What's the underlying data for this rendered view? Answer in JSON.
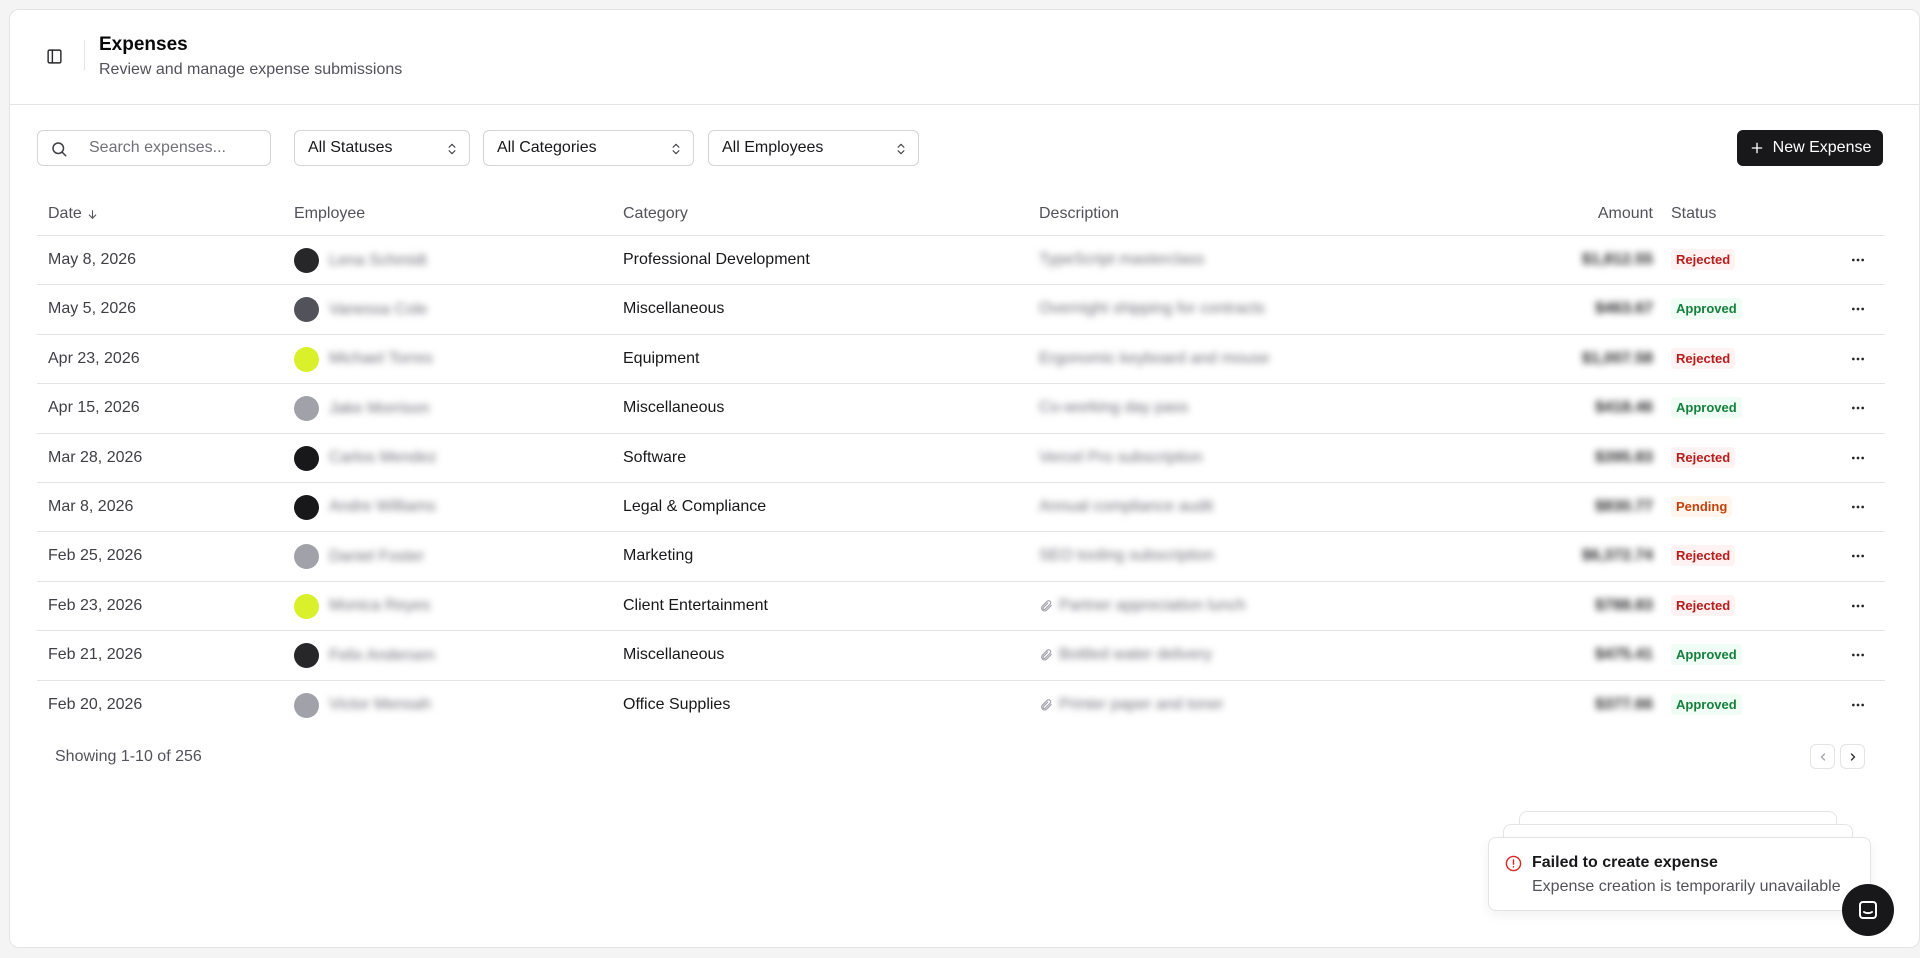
{
  "header": {
    "title": "Expenses",
    "subtitle": "Review and manage expense submissions"
  },
  "toolbar": {
    "search_placeholder": "Search expenses...",
    "status_filter": "All Statuses",
    "category_filter": "All Categories",
    "employee_filter": "All Employees",
    "new_button_label": "New Expense"
  },
  "table": {
    "columns": {
      "date": "Date",
      "employee": "Employee",
      "category": "Category",
      "description": "Description",
      "amount": "Amount",
      "status": "Status"
    },
    "rows": [
      {
        "date": "May 8, 2026",
        "employee": "Lena Schmidt",
        "category": "Professional Development",
        "description": "TypeScript masterclass",
        "amount": "$1,812.55",
        "status": "Rejected",
        "attachment": false,
        "avatar": "#27272a"
      },
      {
        "date": "May 5, 2026",
        "employee": "Vanessa Cole",
        "category": "Miscellaneous",
        "description": "Overnight shipping for contracts",
        "amount": "$463.67",
        "status": "Approved",
        "attachment": false,
        "avatar": "#52525b"
      },
      {
        "date": "Apr 23, 2026",
        "employee": "Michael Torres",
        "category": "Equipment",
        "description": "Ergonomic keyboard and mouse",
        "amount": "$1,007.58",
        "status": "Rejected",
        "attachment": false,
        "avatar": "#d9f02b"
      },
      {
        "date": "Apr 15, 2026",
        "employee": "Jake Morrison",
        "category": "Miscellaneous",
        "description": "Co-working day pass",
        "amount": "$418.46",
        "status": "Approved",
        "attachment": false,
        "avatar": "#a1a1aa"
      },
      {
        "date": "Mar 28, 2026",
        "employee": "Carlos Mendez",
        "category": "Software",
        "description": "Vercel Pro subscription",
        "amount": "$395.83",
        "status": "Rejected",
        "attachment": false,
        "avatar": "#18181b"
      },
      {
        "date": "Mar 8, 2026",
        "employee": "Andre Williams",
        "category": "Legal & Compliance",
        "description": "Annual compliance audit",
        "amount": "$830.77",
        "status": "Pending",
        "attachment": false,
        "avatar": "#18181b"
      },
      {
        "date": "Feb 25, 2026",
        "employee": "Daniel Foster",
        "category": "Marketing",
        "description": "SEO tooling subscription",
        "amount": "$6,372.74",
        "status": "Rejected",
        "attachment": false,
        "avatar": "#a1a1aa"
      },
      {
        "date": "Feb 23, 2026",
        "employee": "Monica Reyes",
        "category": "Client Entertainment",
        "description": "Partner appreciation lunch",
        "amount": "$788.83",
        "status": "Rejected",
        "attachment": true,
        "avatar": "#d9f02b"
      },
      {
        "date": "Feb 21, 2026",
        "employee": "Felix Andersen",
        "category": "Miscellaneous",
        "description": "Bottled water delivery",
        "amount": "$475.41",
        "status": "Approved",
        "attachment": true,
        "avatar": "#27272a"
      },
      {
        "date": "Feb 20, 2026",
        "employee": "Victor Mensah",
        "category": "Office Supplies",
        "description": "Printer paper and toner",
        "amount": "$377.66",
        "status": "Approved",
        "attachment": true,
        "avatar": "#a1a1aa"
      }
    ]
  },
  "status_colors": {
    "Rejected": {
      "bg": "#fef2f2",
      "fg": "#b91c1c"
    },
    "Approved": {
      "bg": "#f0fdf4",
      "fg": "#15803d"
    },
    "Pending": {
      "bg": "#fff7ed",
      "fg": "#c2410c"
    }
  },
  "footer": {
    "showing": "Showing 1-10 of 256"
  },
  "toast": {
    "title": "Failed to create expense",
    "description": "Expense creation is temporarily unavailable",
    "icon": "alert-circle-icon",
    "accent": "#dc2626"
  }
}
